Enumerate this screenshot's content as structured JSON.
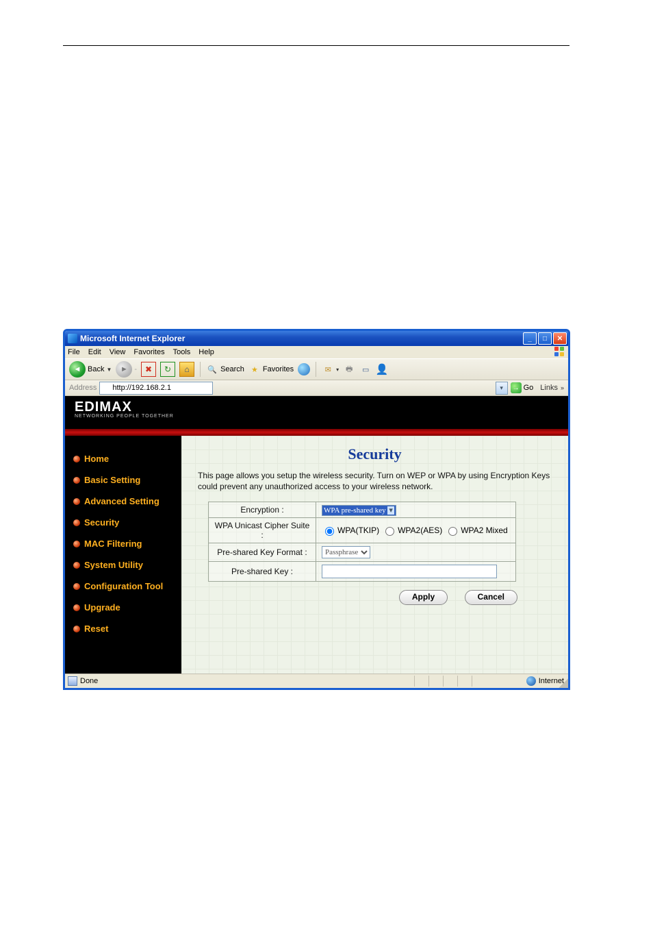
{
  "window": {
    "title": "Microsoft Internet Explorer"
  },
  "menu": [
    "File",
    "Edit",
    "View",
    "Favorites",
    "Tools",
    "Help"
  ],
  "toolbar": {
    "back": "Back",
    "search": "Search",
    "favorites": "Favorites"
  },
  "address": {
    "label": "Address",
    "value": "http://192.168.2.1",
    "go": "Go",
    "links": "Links"
  },
  "brand": {
    "logo": "EDIMAX",
    "tag": "NETWORKING PEOPLE TOGETHER"
  },
  "sidebar": {
    "items": [
      {
        "label": "Home"
      },
      {
        "label": "Basic Setting"
      },
      {
        "label": "Advanced Setting"
      },
      {
        "label": "Security"
      },
      {
        "label": "MAC Filtering"
      },
      {
        "label": "System Utility"
      },
      {
        "label": "Configuration Tool"
      },
      {
        "label": "Upgrade"
      },
      {
        "label": "Reset"
      }
    ]
  },
  "page": {
    "title": "Security",
    "desc": "This page allows you setup the wireless security. Turn on WEP or WPA by using Encryption Keys could prevent any unauthorized access to your wireless network."
  },
  "form": {
    "encryption_label": "Encryption :",
    "encryption_value": "WPA pre-shared key",
    "cipher_label": "WPA Unicast Cipher Suite :",
    "cipher_options": [
      {
        "label": "WPA(TKIP)",
        "checked": true
      },
      {
        "label": "WPA2(AES)",
        "checked": false
      },
      {
        "label": "WPA2 Mixed",
        "checked": false
      }
    ],
    "pskformat_label": "Pre-shared Key Format :",
    "pskformat_value": "Passphrase",
    "psk_label": "Pre-shared Key :",
    "psk_value": ""
  },
  "buttons": {
    "apply": "Apply",
    "cancel": "Cancel"
  },
  "status": {
    "done": "Done",
    "zone": "Internet"
  }
}
